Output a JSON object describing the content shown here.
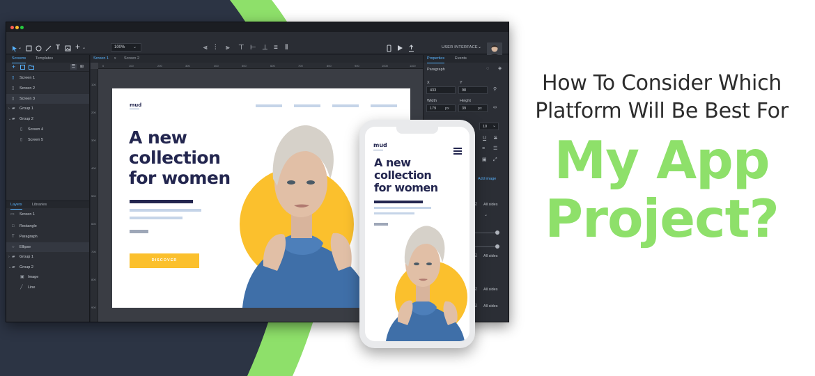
{
  "headline": {
    "line1": "How To Consider Which",
    "line2": "Platform Will Be Best For",
    "line3": "My App",
    "line4": "Project?"
  },
  "colors": {
    "navy_bg": "#2c3444",
    "green_accent": "#8ee06a",
    "headline_dark": "#2c2c2c",
    "editor_bg": "#2b2e35",
    "selection_blue": "#58b4ff",
    "mock_navy": "#23264f",
    "mock_yellow": "#fbc02d"
  },
  "toolbar": {
    "zoom_value": "100%",
    "mode_label": "USER INTERFACE",
    "tools": [
      "select-icon",
      "rectangle-icon",
      "ellipse-icon",
      "line-icon",
      "text-icon",
      "image-icon",
      "add-icon"
    ],
    "align_tools": [
      "align-left-icon",
      "align-center-icon",
      "align-right-icon",
      "align-top-icon",
      "align-middle-icon",
      "align-bottom-icon",
      "distribute-icon",
      "distribute-h-icon"
    ],
    "preview_tools": [
      "device-icon",
      "play-icon",
      "export-icon"
    ]
  },
  "left_panel": {
    "tabs": [
      "Screens",
      "Templates"
    ],
    "screens": [
      "Screen 1",
      "Screen 2",
      "Screen 3",
      "Group 1",
      "Group 2",
      "Screen 4",
      "Screen 5"
    ],
    "layer_tabs": [
      "Layers",
      "Libraries"
    ],
    "layers": [
      "Screen 1",
      "Rectangle",
      "Paragraph",
      "Ellipse",
      "Group 1",
      "Group 2",
      "Image",
      "Line"
    ]
  },
  "canvas": {
    "tabs": [
      "Screen 1",
      "Screen 2"
    ],
    "ruler_ticks": [
      "0",
      "100",
      "200",
      "300",
      "400",
      "500",
      "600",
      "700",
      "800",
      "900",
      "1000",
      "1100"
    ],
    "ruler_v_ticks": [
      "100",
      "200",
      "300",
      "400",
      "500",
      "600",
      "700",
      "800",
      "900"
    ]
  },
  "right_panel": {
    "tabs": [
      "Properties",
      "Events"
    ],
    "element": "Paragraph",
    "x_label": "X",
    "x_value": "433",
    "y_label": "Y",
    "y_value": "98",
    "width_label": "Width",
    "width_value": "179",
    "height_label": "Height",
    "height_value": "39",
    "unit": "px",
    "font_size": "10",
    "add_image": "Add image",
    "all_sides": "All sides"
  },
  "mockup": {
    "logo": "mud",
    "hero_line1": "A new",
    "hero_line2": "collection",
    "hero_line3": "for women",
    "cta": "DISCOVER"
  },
  "phone": {
    "logo": "mud",
    "hero_line1": "A new",
    "hero_line2": "collection",
    "hero_line3": "for women"
  }
}
